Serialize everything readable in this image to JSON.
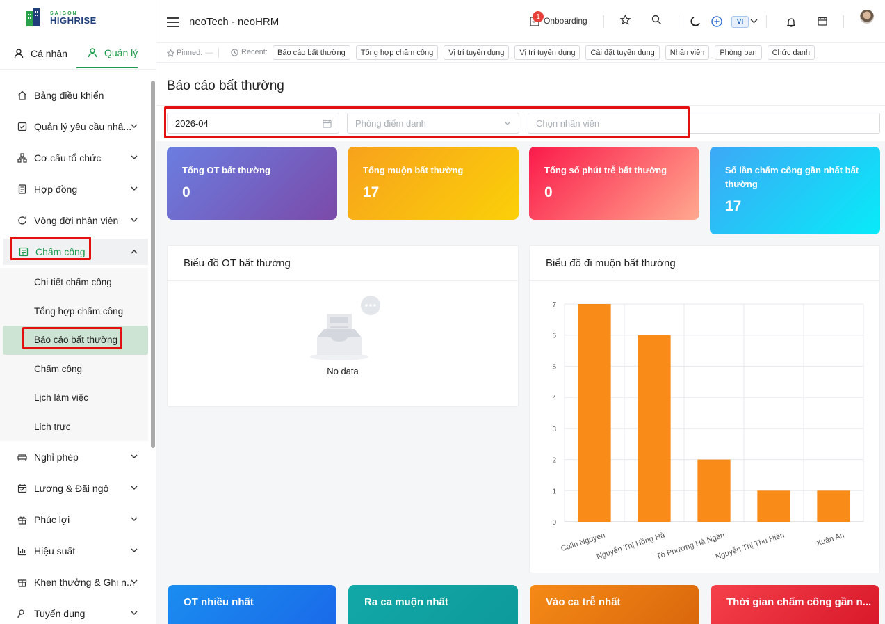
{
  "brand": {
    "top": "SAIGON",
    "bottom": "HIGHRISE"
  },
  "role_tabs": {
    "personal": "Cá nhân",
    "admin": "Quản lý"
  },
  "menu": {
    "items_top": [
      {
        "label": "Bảng điều khiển",
        "icon": "home-icon",
        "chevron": false
      },
      {
        "label": "Quản lý yêu cầu nhâ...",
        "icon": "check-square-icon",
        "chevron": true
      },
      {
        "label": "Cơ cấu tổ chức",
        "icon": "org-chart-icon",
        "chevron": true
      },
      {
        "label": "Hợp đồng",
        "icon": "contract-icon",
        "chevron": true
      },
      {
        "label": "Vòng đời nhân viên",
        "icon": "refresh-icon",
        "chevron": true
      }
    ],
    "open_item": {
      "label": "Chấm công",
      "icon": "timesheet-icon"
    },
    "sub_items": [
      "Chi tiết chấm công",
      "Tổng hợp chấm công",
      "Báo cáo bất thường",
      "Chấm công",
      "Lịch làm việc",
      "Lịch trực"
    ],
    "active_sub": 2,
    "items_bottom": [
      {
        "label": "Nghỉ phép",
        "icon": "sofa-icon"
      },
      {
        "label": "Lương & Đãi ngộ",
        "icon": "calendar-money-icon"
      },
      {
        "label": "Phúc lợi",
        "icon": "gift-icon"
      },
      {
        "label": "Hiệu suất",
        "icon": "bar-chart-icon"
      },
      {
        "label": "Khen thưởng & Ghi n...",
        "icon": "award-icon"
      },
      {
        "label": "Tuyển dụng",
        "icon": "recruit-icon"
      }
    ]
  },
  "topbar": {
    "title": "neoTech - neoHRM",
    "onboarding_label": "Onboarding",
    "onboarding_badge": "1",
    "lang": "VI"
  },
  "quickbar": {
    "pinned_label": "Pinned:",
    "pinned_value": "—",
    "recent_label": "Recent:",
    "recent_items": [
      "Báo cáo bất thường",
      "Tổng hợp chấm công",
      "Vị trí tuyển dụng",
      "Vị trí tuyển dụng",
      "Cài đặt tuyển dụng",
      "Nhân viên",
      "Phòng ban",
      "Chức danh"
    ]
  },
  "page": {
    "title": "Báo cáo bất thường"
  },
  "filters": {
    "month_value": "2026-04",
    "department_placeholder": "Phòng điểm danh",
    "employee_placeholder": "Chọn nhân viên"
  },
  "stats": [
    {
      "label": "Tổng OT bất thường",
      "value": "0"
    },
    {
      "label": "Tổng muộn bất thường",
      "value": "17"
    },
    {
      "label": "Tổng số phút trễ bất thường",
      "value": "0"
    },
    {
      "label": "Số lần chấm công gần nhất bất thường",
      "value": "17"
    }
  ],
  "ot_panel": {
    "title": "Biểu đồ OT bất thường",
    "empty_text": "No data"
  },
  "late_panel": {
    "title": "Biểu đồ đi muộn bất thường"
  },
  "chart_data": {
    "type": "bar",
    "title": "Biểu đồ đi muộn bất thường",
    "categories": [
      "Colin Nguyen",
      "Nguyễn Thị Hồng Hà",
      "Tô Phương Hà Ngân",
      "Nguyễn Thị Thu Hiền",
      "Xuân An"
    ],
    "values": [
      7,
      6,
      2,
      1,
      1
    ],
    "ylim": [
      0,
      7
    ],
    "yticks": [
      "0",
      "1",
      "2",
      "3",
      "4",
      "5",
      "6",
      "7"
    ],
    "grid": true,
    "bar_color": "#f98c19"
  },
  "bottom_cards": [
    "OT nhiều nhất",
    "Ra ca muộn nhất",
    "Vào ca trễ nhất",
    "Thời gian chấm công gần n..."
  ],
  "colors": {
    "accent": "#1a9a4b",
    "highlight": "#e31010"
  }
}
